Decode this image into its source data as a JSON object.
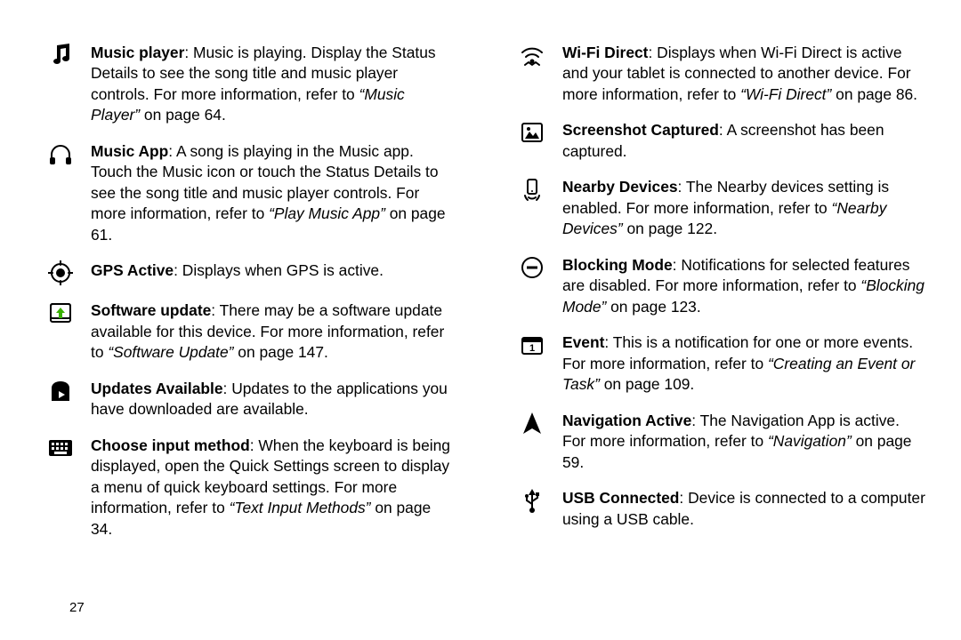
{
  "page_number": "27",
  "left": [
    {
      "icon": "music-note-icon",
      "title": "Music player",
      "body_pre": ": Music is playing. Display the Status Details to see the song title and music player controls. For more information, refer to ",
      "ref": "“Music Player”",
      "body_post": " on page 64."
    },
    {
      "icon": "headphones-icon",
      "title": "Music App",
      "body_pre": ": A song is playing in the Music app. Touch the Music icon or touch the Status Details to see the song title and music player controls. For more information, refer to ",
      "ref": "“Play Music App”",
      "body_post": " on page 61."
    },
    {
      "icon": "gps-icon",
      "title": "GPS Active",
      "body_pre": ": Displays when GPS is active.",
      "ref": "",
      "body_post": ""
    },
    {
      "icon": "software-update-icon",
      "title": "Software update",
      "body_pre": ": There may be a software update available for this device. For more information, refer to ",
      "ref": "“Software Update”",
      "body_post": " on page 147."
    },
    {
      "icon": "updates-available-icon",
      "title": "Updates Available",
      "body_pre": ": Updates to the applications you have downloaded are available.",
      "ref": "",
      "body_post": ""
    },
    {
      "icon": "keyboard-icon",
      "title": "Choose input method",
      "body_pre": ": When the keyboard is being displayed, open the Quick Settings screen to display a menu of quick keyboard settings. For more information, refer to ",
      "ref": "“Text Input Methods”",
      "body_post": " on page 34."
    }
  ],
  "right": [
    {
      "icon": "wifi-direct-icon",
      "title": "Wi-Fi Direct",
      "body_pre": ": Displays when Wi-Fi Direct is active and your tablet is connected to another device. For more information, refer to ",
      "ref": "“Wi-Fi Direct”",
      "body_post": " on page 86."
    },
    {
      "icon": "screenshot-icon",
      "title": "Screenshot Captured",
      "body_pre": ": A screenshot has been captured.",
      "ref": "",
      "body_post": ""
    },
    {
      "icon": "nearby-devices-icon",
      "title": "Nearby Devices",
      "body_pre": ": The Nearby devices setting is enabled. For more information, refer to ",
      "ref": "“Nearby Devices”",
      "body_post": " on page 122."
    },
    {
      "icon": "blocking-mode-icon",
      "title": "Blocking Mode",
      "body_pre": ": Notifications for selected features are disabled. For more information, refer to ",
      "ref": "“Blocking Mode”",
      "body_post": " on page 123."
    },
    {
      "icon": "event-icon",
      "title": "Event",
      "body_pre": ": This is a notification for one or more events. For more information, refer to ",
      "ref": "“Creating an Event or Task”",
      "body_post": " on page 109."
    },
    {
      "icon": "navigation-icon",
      "title": "Navigation Active",
      "body_pre": ": The Navigation App is active. For more information, refer to ",
      "ref": "“Navigation”",
      "body_post": " on page 59."
    },
    {
      "icon": "usb-icon",
      "title": "USB Connected",
      "body_pre": ": Device is connected to a computer using a USB cable.",
      "ref": "",
      "body_post": ""
    }
  ]
}
